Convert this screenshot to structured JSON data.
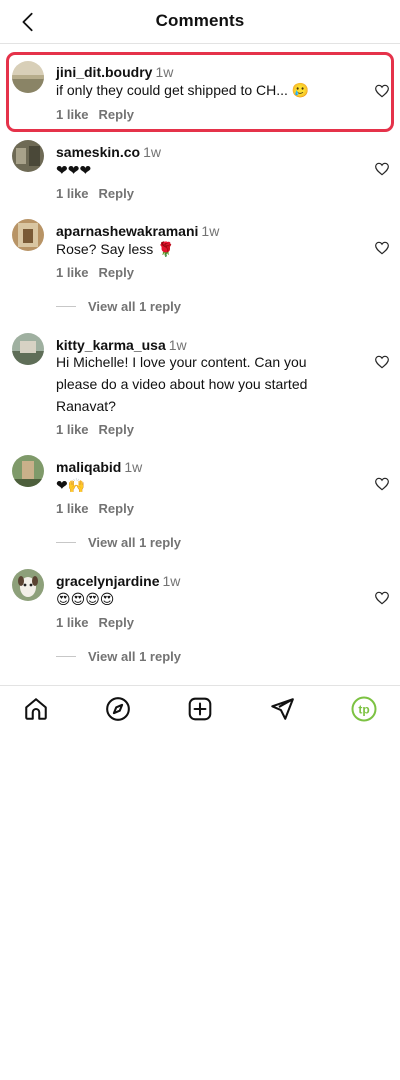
{
  "header": {
    "title": "Comments"
  },
  "comments": [
    {
      "username": "jini_dit.boudry",
      "time": "1w",
      "text": "if only they could get shipped to CH... 🥲",
      "likes": "1 like",
      "reply": "Reply"
    },
    {
      "username": "sameskin.co",
      "time": "1w",
      "text": "❤❤❤",
      "likes": "1 like",
      "reply": "Reply"
    },
    {
      "username": "aparnashewakramani",
      "time": "1w",
      "text": "Rose? Say less 🌹",
      "likes": "1 like",
      "reply": "Reply",
      "view_replies": "View all 1 reply"
    },
    {
      "username": "kitty_karma_usa",
      "time": "1w",
      "text": "Hi Michelle! I love your content. Can you please do a video about how you started Ranavat?",
      "likes": "1 like",
      "reply": "Reply"
    },
    {
      "username": "maliqabid",
      "time": "1w",
      "text": "❤🙌",
      "likes": "1 like",
      "reply": "Reply",
      "view_replies": "View all 1 reply"
    },
    {
      "username": "gracelynjardine",
      "time": "1w",
      "text": "😍😍😍😍",
      "likes": "1 like",
      "reply": "Reply",
      "view_replies": "View all 1 reply"
    }
  ],
  "tabbar": {
    "items": [
      "home-icon",
      "explore-icon",
      "new-post-icon",
      "direct-icon",
      "profile-avatar"
    ],
    "profile_initials": "tp"
  },
  "colors": {
    "highlight": "#e5324a",
    "muted": "#737373",
    "profile_accent": "#7cc242"
  }
}
